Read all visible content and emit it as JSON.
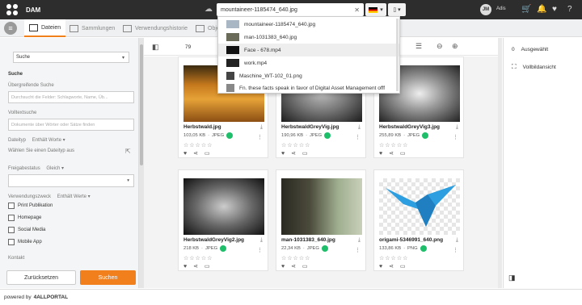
{
  "app": {
    "title": "DAM"
  },
  "search": {
    "value": "mountaineer-1185474_640.jpg"
  },
  "user": {
    "initials": "JM",
    "name": "Adis"
  },
  "tabs": [
    {
      "label": "Dateien",
      "active": true
    },
    {
      "label": "Sammlungen",
      "active": false
    },
    {
      "label": "Verwendungshistorie",
      "active": false
    },
    {
      "label": "Obje",
      "active": false
    }
  ],
  "dropdown": {
    "items": [
      {
        "label": "mountaineer-1185474_640.jpg",
        "icon": "image-icon"
      },
      {
        "label": "man-1031383_640.jpg",
        "icon": "image-icon"
      },
      {
        "label": "Face - 678.mp4",
        "icon": "video-icon"
      },
      {
        "label": "work.mp4",
        "icon": "video-icon"
      },
      {
        "label": "Maschine_WT-102_01.png",
        "icon": "image-icon"
      },
      {
        "label": "Fn. these facts speak in favor of Digital Asset Management offf",
        "icon": "document-icon"
      }
    ]
  },
  "filters": {
    "select": "Suche",
    "section": "Suche",
    "fulltext_label": "Übergreifende Suche",
    "fulltext_placeholder": "Durchsucht die Felder: Schlagworte, Name, Üb...",
    "fulltext2_label": "Volltextsuche",
    "fulltext2_placeholder": "Dokumente über Wörter oder Sätze finden",
    "filetype_label": "Dateityp",
    "filetype_mode": "Enthält Worte",
    "filetype_placeholder": "Wählen Sie einen Dateityp aus",
    "release_label": "Freigabestatus",
    "release_mode": "Gleich",
    "usage_label": "Verwendungszweck",
    "usage_mode": "Enthält Werte",
    "usage_options": [
      "Print Publikation",
      "Homepage",
      "Social Media",
      "Mobile App"
    ],
    "contact_label": "Kontakt",
    "reset_label": "Zurücksetzen",
    "search_label": "Suchen"
  },
  "toolbar": {
    "count": "79"
  },
  "cards": [
    {
      "name": "Herbstwald.jpg",
      "size": "103,05 KB",
      "type": "JPEG"
    },
    {
      "name": "HerbstwaldGreyVig.jpg",
      "size": "190,96 KB",
      "type": "JPEG"
    },
    {
      "name": "HerbstwaldGreyVig3.jpg",
      "size": "255,89 KB",
      "type": "JPEG"
    },
    {
      "name": "HerbstwaldGreyVig2.jpg",
      "size": "218 KB",
      "type": "JPEG"
    },
    {
      "name": "man-1031383_640.jpg",
      "size": "22,34 KB",
      "type": "JPEG"
    },
    {
      "name": "origami-5346991_640.png",
      "size": "133,86 KB",
      "type": "PNG"
    }
  ],
  "right_panel": {
    "selected_count": "0",
    "selected_label": "Ausgewählt",
    "fullscreen_label": "Vollbildansicht"
  },
  "footer": {
    "prefix": "powered by",
    "brand": "4ALLPORTAL"
  },
  "colors": {
    "accent": "#f07f1c",
    "status_green": "#1fbe6a",
    "topbar": "#2d2d2d"
  }
}
